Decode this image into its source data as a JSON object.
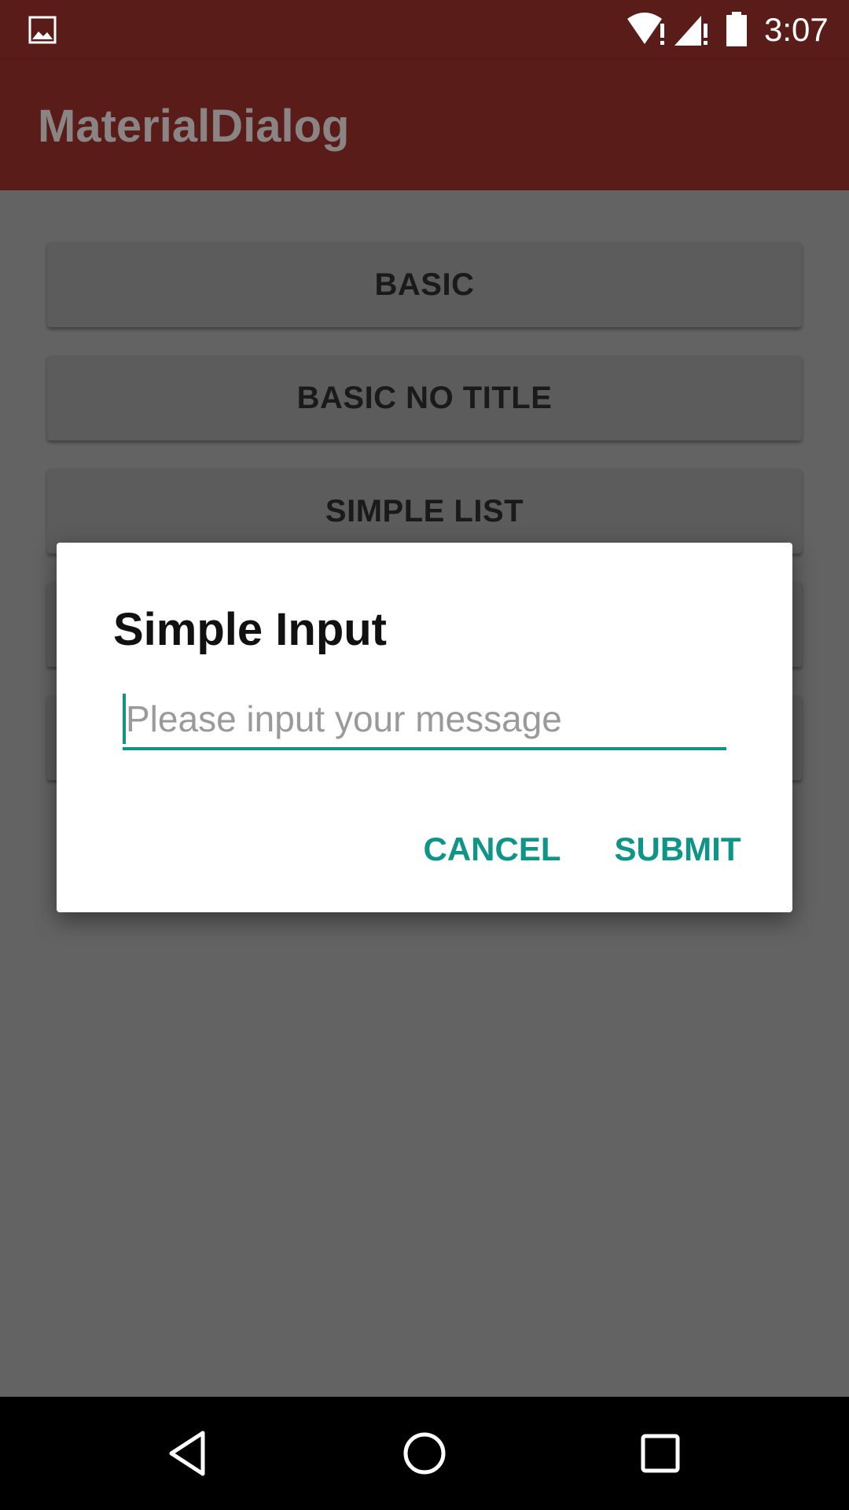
{
  "status_bar": {
    "time": "3:07",
    "icons": [
      "gallery-icon",
      "wifi-icon",
      "signal-icon",
      "battery-icon"
    ]
  },
  "app_bar": {
    "title": "MaterialDialog"
  },
  "menu": {
    "buttons": [
      {
        "label": "BASIC"
      },
      {
        "label": "BASIC NO TITLE"
      },
      {
        "label": "SIMPLE LIST"
      },
      {
        "label": ""
      },
      {
        "label": ""
      }
    ]
  },
  "dialog": {
    "title": "Simple Input",
    "input_value": "",
    "input_placeholder": "Please input your message",
    "cancel_label": "CANCEL",
    "submit_label": "SUBMIT"
  },
  "nav_bar": {
    "icons": [
      "back-icon",
      "home-icon",
      "recents-icon"
    ]
  },
  "colors": {
    "primary_dark": "#5a1c18",
    "accent": "#0f9488",
    "scrim": "#636363"
  }
}
